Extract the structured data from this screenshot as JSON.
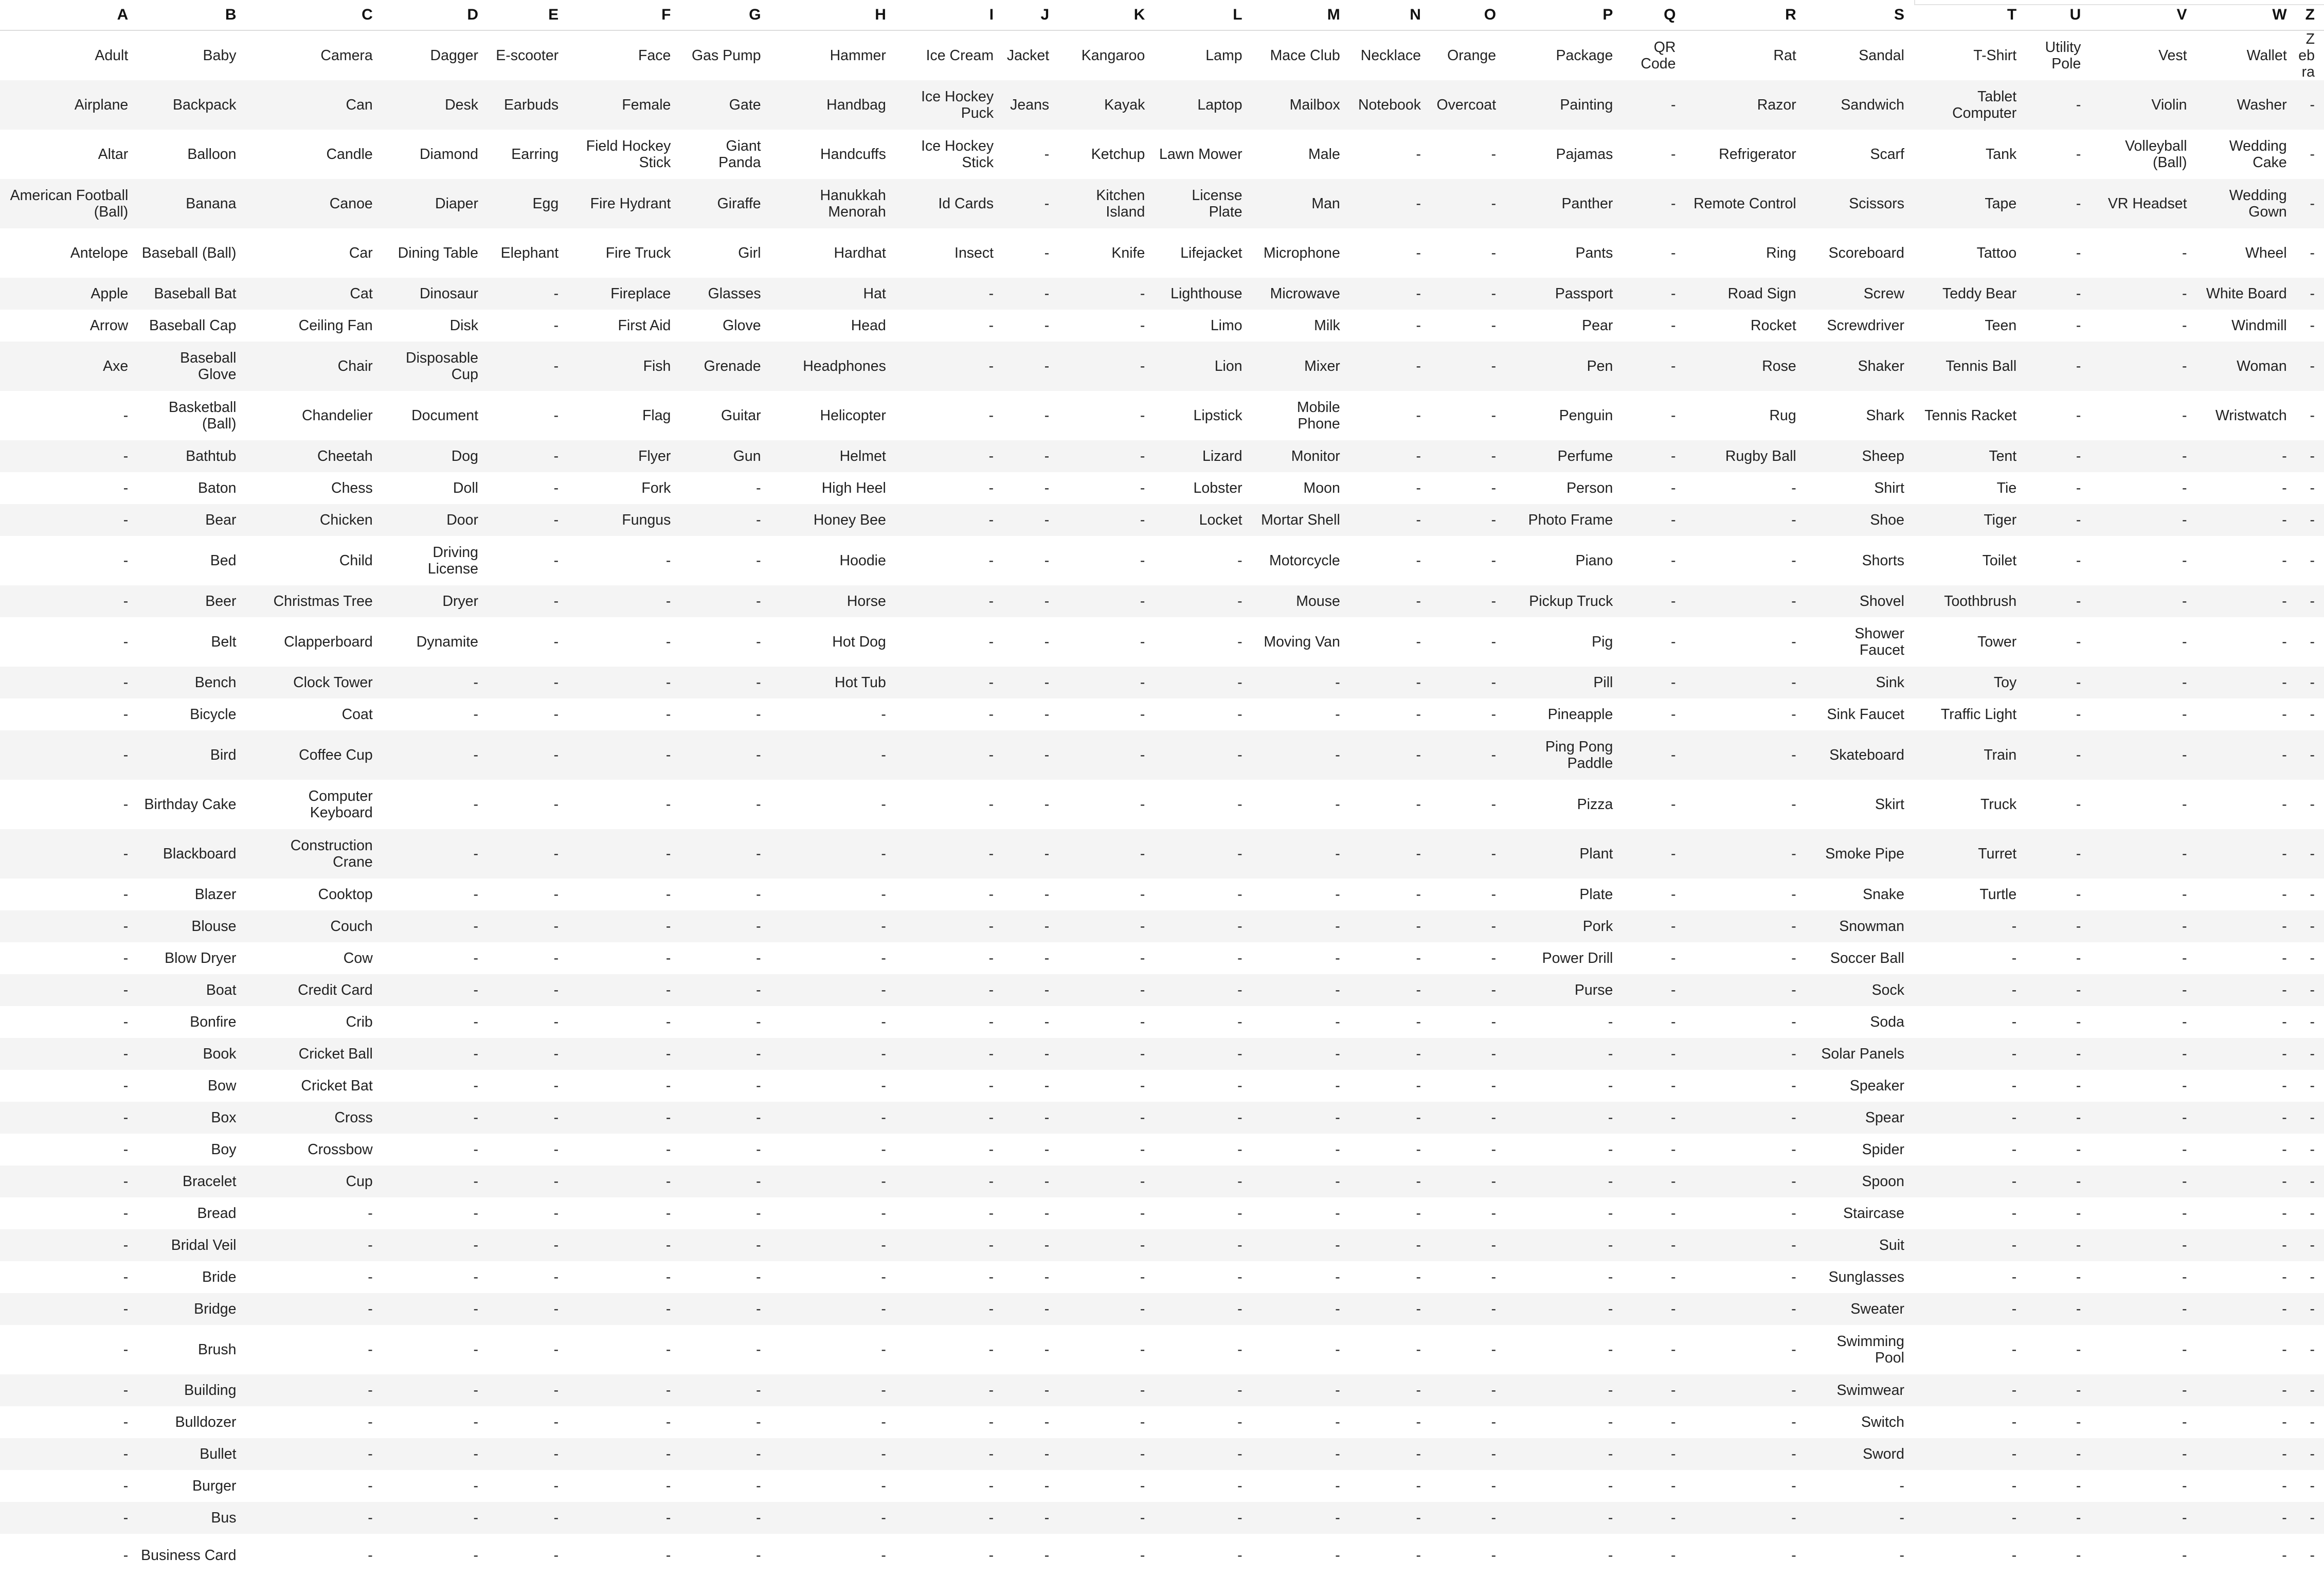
{
  "columns": [
    "A",
    "B",
    "C",
    "D",
    "E",
    "F",
    "G",
    "H",
    "I",
    "J",
    "K",
    "L",
    "M",
    "N",
    "O",
    "P",
    "Q",
    "R",
    "S",
    "T",
    "U",
    "V",
    "W",
    "Z"
  ],
  "rows": [
    [
      "Adult",
      "Baby",
      "Camera",
      "Dagger",
      "E-scooter",
      "Face",
      "Gas Pump",
      "Hammer",
      "Ice Cream",
      "Jacket",
      "Kangaroo",
      "Lamp",
      "Mace Club",
      "Necklace",
      "Orange",
      "Package",
      "QR Code",
      "Rat",
      "Sandal",
      "T-Shirt",
      "Utility Pole",
      "Vest",
      "Wallet",
      "Zebra"
    ],
    [
      "Airplane",
      "Backpack",
      "Can",
      "Desk",
      "Earbuds",
      "Female",
      "Gate",
      "Handbag",
      "Ice Hockey Puck",
      "Jeans",
      "Kayak",
      "Laptop",
      "Mailbox",
      "Notebook",
      "Overcoat",
      "Painting",
      "-",
      "Razor",
      "Sandwich",
      "Tablet Computer",
      "-",
      "Violin",
      "Washer",
      "-"
    ],
    [
      "Altar",
      "Balloon",
      "Candle",
      "Diamond",
      "Earring",
      "Field Hockey Stick",
      "Giant Panda",
      "Handcuffs",
      "Ice Hockey Stick",
      "-",
      "Ketchup",
      "Lawn Mower",
      "Male",
      "-",
      "-",
      "Pajamas",
      "-",
      "Refrigerator",
      "Scarf",
      "Tank",
      "-",
      "Volleyball (Ball)",
      "Wedding Cake",
      "-"
    ],
    [
      "American Football (Ball)",
      "Banana",
      "Canoe",
      "Diaper",
      "Egg",
      "Fire Hydrant",
      "Giraffe",
      "Hanukkah Menorah",
      "Id Cards",
      "-",
      "Kitchen Island",
      "License Plate",
      "Man",
      "-",
      "-",
      "Panther",
      "-",
      "Remote Control",
      "Scissors",
      "Tape",
      "-",
      "VR Headset",
      "Wedding Gown",
      "-"
    ],
    [
      "Antelope",
      "Baseball (Ball)",
      "Car",
      "Dining Table",
      "Elephant",
      "Fire Truck",
      "Girl",
      "Hardhat",
      "Insect",
      "-",
      "Knife",
      "Lifejacket",
      "Microphone",
      "-",
      "-",
      "Pants",
      "-",
      "Ring",
      "Scoreboard",
      "Tattoo",
      "-",
      "-",
      "Wheel",
      "-"
    ],
    [
      "Apple",
      "Baseball Bat",
      "Cat",
      "Dinosaur",
      "-",
      "Fireplace",
      "Glasses",
      "Hat",
      "-",
      "-",
      "-",
      "Lighthouse",
      "Microwave",
      "-",
      "-",
      "Passport",
      "-",
      "Road Sign",
      "Screw",
      "Teddy Bear",
      "-",
      "-",
      "White Board",
      "-"
    ],
    [
      "Arrow",
      "Baseball Cap",
      "Ceiling Fan",
      "Disk",
      "-",
      "First Aid",
      "Glove",
      "Head",
      "-",
      "-",
      "-",
      "Limo",
      "Milk",
      "-",
      "-",
      "Pear",
      "-",
      "Rocket",
      "Screwdriver",
      "Teen",
      "-",
      "-",
      "Windmill",
      "-"
    ],
    [
      "Axe",
      "Baseball Glove",
      "Chair",
      "Disposable Cup",
      "-",
      "Fish",
      "Grenade",
      "Headphones",
      "-",
      "-",
      "-",
      "Lion",
      "Mixer",
      "-",
      "-",
      "Pen",
      "-",
      "Rose",
      "Shaker",
      "Tennis Ball",
      "-",
      "-",
      "Woman",
      "-"
    ],
    [
      "-",
      "Basketball (Ball)",
      "Chandelier",
      "Document",
      "-",
      "Flag",
      "Guitar",
      "Helicopter",
      "-",
      "-",
      "-",
      "Lipstick",
      "Mobile Phone",
      "-",
      "-",
      "Penguin",
      "-",
      "Rug",
      "Shark",
      "Tennis Racket",
      "-",
      "-",
      "Wristwatch",
      "-"
    ],
    [
      "-",
      "Bathtub",
      "Cheetah",
      "Dog",
      "-",
      "Flyer",
      "Gun",
      "Helmet",
      "-",
      "-",
      "-",
      "Lizard",
      "Monitor",
      "-",
      "-",
      "Perfume",
      "-",
      "Rugby Ball",
      "Sheep",
      "Tent",
      "-",
      "-",
      "-",
      "-"
    ],
    [
      "-",
      "Baton",
      "Chess",
      "Doll",
      "-",
      "Fork",
      "-",
      "High Heel",
      "-",
      "-",
      "-",
      "Lobster",
      "Moon",
      "-",
      "-",
      "Person",
      "-",
      "-",
      "Shirt",
      "Tie",
      "-",
      "-",
      "-",
      "-"
    ],
    [
      "-",
      "Bear",
      "Chicken",
      "Door",
      "-",
      "Fungus",
      "-",
      "Honey Bee",
      "-",
      "-",
      "-",
      "Locket",
      "Mortar Shell",
      "-",
      "-",
      "Photo Frame",
      "-",
      "-",
      "Shoe",
      "Tiger",
      "-",
      "-",
      "-",
      "-"
    ],
    [
      "-",
      "Bed",
      "Child",
      "Driving License",
      "-",
      "-",
      "-",
      "Hoodie",
      "-",
      "-",
      "-",
      "-",
      "Motorcycle",
      "-",
      "-",
      "Piano",
      "-",
      "-",
      "Shorts",
      "Toilet",
      "-",
      "-",
      "-",
      "-"
    ],
    [
      "-",
      "Beer",
      "Christmas Tree",
      "Dryer",
      "-",
      "-",
      "-",
      "Horse",
      "-",
      "-",
      "-",
      "-",
      "Mouse",
      "-",
      "-",
      "Pickup Truck",
      "-",
      "-",
      "Shovel",
      "Toothbrush",
      "-",
      "-",
      "-",
      "-"
    ],
    [
      "-",
      "Belt",
      "Clapperboard",
      "Dynamite",
      "-",
      "-",
      "-",
      "Hot Dog",
      "-",
      "-",
      "-",
      "-",
      "Moving Van",
      "-",
      "-",
      "Pig",
      "-",
      "-",
      "Shower Faucet",
      "Tower",
      "-",
      "-",
      "-",
      "-"
    ],
    [
      "-",
      "Bench",
      "Clock Tower",
      "-",
      "-",
      "-",
      "-",
      "Hot Tub",
      "-",
      "-",
      "-",
      "-",
      "-",
      "-",
      "-",
      "Pill",
      "-",
      "-",
      "Sink",
      "Toy",
      "-",
      "-",
      "-",
      "-"
    ],
    [
      "-",
      "Bicycle",
      "Coat",
      "-",
      "-",
      "-",
      "-",
      "-",
      "-",
      "-",
      "-",
      "-",
      "-",
      "-",
      "-",
      "Pineapple",
      "-",
      "-",
      "Sink Faucet",
      "Traffic Light",
      "-",
      "-",
      "-",
      "-"
    ],
    [
      "-",
      "Bird",
      "Coffee Cup",
      "-",
      "-",
      "-",
      "-",
      "-",
      "-",
      "-",
      "-",
      "-",
      "-",
      "-",
      "-",
      "Ping Pong Paddle",
      "-",
      "-",
      "Skateboard",
      "Train",
      "-",
      "-",
      "-",
      "-"
    ],
    [
      "-",
      "Birthday Cake",
      "Computer Keyboard",
      "-",
      "-",
      "-",
      "-",
      "-",
      "-",
      "-",
      "-",
      "-",
      "-",
      "-",
      "-",
      "Pizza",
      "-",
      "-",
      "Skirt",
      "Truck",
      "-",
      "-",
      "-",
      "-"
    ],
    [
      "-",
      "Blackboard",
      "Construction Crane",
      "-",
      "-",
      "-",
      "-",
      "-",
      "-",
      "-",
      "-",
      "-",
      "-",
      "-",
      "-",
      "Plant",
      "-",
      "-",
      "Smoke Pipe",
      "Turret",
      "-",
      "-",
      "-",
      "-"
    ],
    [
      "-",
      "Blazer",
      "Cooktop",
      "-",
      "-",
      "-",
      "-",
      "-",
      "-",
      "-",
      "-",
      "-",
      "-",
      "-",
      "-",
      "Plate",
      "-",
      "-",
      "Snake",
      "Turtle",
      "-",
      "-",
      "-",
      "-"
    ],
    [
      "-",
      "Blouse",
      "Couch",
      "-",
      "-",
      "-",
      "-",
      "-",
      "-",
      "-",
      "-",
      "-",
      "-",
      "-",
      "-",
      "Pork",
      "-",
      "-",
      "Snowman",
      "-",
      "-",
      "-",
      "-",
      "-"
    ],
    [
      "-",
      "Blow Dryer",
      "Cow",
      "-",
      "-",
      "-",
      "-",
      "-",
      "-",
      "-",
      "-",
      "-",
      "-",
      "-",
      "-",
      "Power Drill",
      "-",
      "-",
      "Soccer Ball",
      "-",
      "-",
      "-",
      "-",
      "-"
    ],
    [
      "-",
      "Boat",
      "Credit Card",
      "-",
      "-",
      "-",
      "-",
      "-",
      "-",
      "-",
      "-",
      "-",
      "-",
      "-",
      "-",
      "Purse",
      "-",
      "-",
      "Sock",
      "-",
      "-",
      "-",
      "-",
      "-"
    ],
    [
      "-",
      "Bonfire",
      "Crib",
      "-",
      "-",
      "-",
      "-",
      "-",
      "-",
      "-",
      "-",
      "-",
      "-",
      "-",
      "-",
      "-",
      "-",
      "-",
      "Soda",
      "-",
      "-",
      "-",
      "-",
      "-"
    ],
    [
      "-",
      "Book",
      "Cricket Ball",
      "-",
      "-",
      "-",
      "-",
      "-",
      "-",
      "-",
      "-",
      "-",
      "-",
      "-",
      "-",
      "-",
      "-",
      "-",
      "Solar Panels",
      "-",
      "-",
      "-",
      "-",
      "-"
    ],
    [
      "-",
      "Bow",
      "Cricket Bat",
      "-",
      "-",
      "-",
      "-",
      "-",
      "-",
      "-",
      "-",
      "-",
      "-",
      "-",
      "-",
      "-",
      "-",
      "-",
      "Speaker",
      "-",
      "-",
      "-",
      "-",
      "-"
    ],
    [
      "-",
      "Box",
      "Cross",
      "-",
      "-",
      "-",
      "-",
      "-",
      "-",
      "-",
      "-",
      "-",
      "-",
      "-",
      "-",
      "-",
      "-",
      "-",
      "Spear",
      "-",
      "-",
      "-",
      "-",
      "-"
    ],
    [
      "-",
      "Boy",
      "Crossbow",
      "-",
      "-",
      "-",
      "-",
      "-",
      "-",
      "-",
      "-",
      "-",
      "-",
      "-",
      "-",
      "-",
      "-",
      "-",
      "Spider",
      "-",
      "-",
      "-",
      "-",
      "-"
    ],
    [
      "-",
      "Bracelet",
      "Cup",
      "-",
      "-",
      "-",
      "-",
      "-",
      "-",
      "-",
      "-",
      "-",
      "-",
      "-",
      "-",
      "-",
      "-",
      "-",
      "Spoon",
      "-",
      "-",
      "-",
      "-",
      "-"
    ],
    [
      "-",
      "Bread",
      "-",
      "-",
      "-",
      "-",
      "-",
      "-",
      "-",
      "-",
      "-",
      "-",
      "-",
      "-",
      "-",
      "-",
      "-",
      "-",
      "Staircase",
      "-",
      "-",
      "-",
      "-",
      "-"
    ],
    [
      "-",
      "Bridal Veil",
      "-",
      "-",
      "-",
      "-",
      "-",
      "-",
      "-",
      "-",
      "-",
      "-",
      "-",
      "-",
      "-",
      "-",
      "-",
      "-",
      "Suit",
      "-",
      "-",
      "-",
      "-",
      "-"
    ],
    [
      "-",
      "Bride",
      "-",
      "-",
      "-",
      "-",
      "-",
      "-",
      "-",
      "-",
      "-",
      "-",
      "-",
      "-",
      "-",
      "-",
      "-",
      "-",
      "Sunglasses",
      "-",
      "-",
      "-",
      "-",
      "-"
    ],
    [
      "-",
      "Bridge",
      "-",
      "-",
      "-",
      "-",
      "-",
      "-",
      "-",
      "-",
      "-",
      "-",
      "-",
      "-",
      "-",
      "-",
      "-",
      "-",
      "Sweater",
      "-",
      "-",
      "-",
      "-",
      "-"
    ],
    [
      "-",
      "Brush",
      "-",
      "-",
      "-",
      "-",
      "-",
      "-",
      "-",
      "-",
      "-",
      "-",
      "-",
      "-",
      "-",
      "-",
      "-",
      "-",
      "Swimming Pool",
      "-",
      "-",
      "-",
      "-",
      "-"
    ],
    [
      "-",
      "Building",
      "-",
      "-",
      "-",
      "-",
      "-",
      "-",
      "-",
      "-",
      "-",
      "-",
      "-",
      "-",
      "-",
      "-",
      "-",
      "-",
      "Swimwear",
      "-",
      "-",
      "-",
      "-",
      "-"
    ],
    [
      "-",
      "Bulldozer",
      "-",
      "-",
      "-",
      "-",
      "-",
      "-",
      "-",
      "-",
      "-",
      "-",
      "-",
      "-",
      "-",
      "-",
      "-",
      "-",
      "Switch",
      "-",
      "-",
      "-",
      "-",
      "-"
    ],
    [
      "-",
      "Bullet",
      "-",
      "-",
      "-",
      "-",
      "-",
      "-",
      "-",
      "-",
      "-",
      "-",
      "-",
      "-",
      "-",
      "-",
      "-",
      "-",
      "Sword",
      "-",
      "-",
      "-",
      "-",
      "-"
    ],
    [
      "-",
      "Burger",
      "-",
      "-",
      "-",
      "-",
      "-",
      "-",
      "-",
      "-",
      "-",
      "-",
      "-",
      "-",
      "-",
      "-",
      "-",
      "-",
      "-",
      "-",
      "-",
      "-",
      "-",
      "-"
    ],
    [
      "-",
      "Bus",
      "-",
      "-",
      "-",
      "-",
      "-",
      "-",
      "-",
      "-",
      "-",
      "-",
      "-",
      "-",
      "-",
      "-",
      "-",
      "-",
      "-",
      "-",
      "-",
      "-",
      "-",
      "-"
    ],
    [
      "-",
      "Business Card",
      "-",
      "-",
      "-",
      "-",
      "-",
      "-",
      "-",
      "-",
      "-",
      "-",
      "-",
      "-",
      "-",
      "-",
      "-",
      "-",
      "-",
      "-",
      "-",
      "-",
      "-",
      "-"
    ]
  ]
}
